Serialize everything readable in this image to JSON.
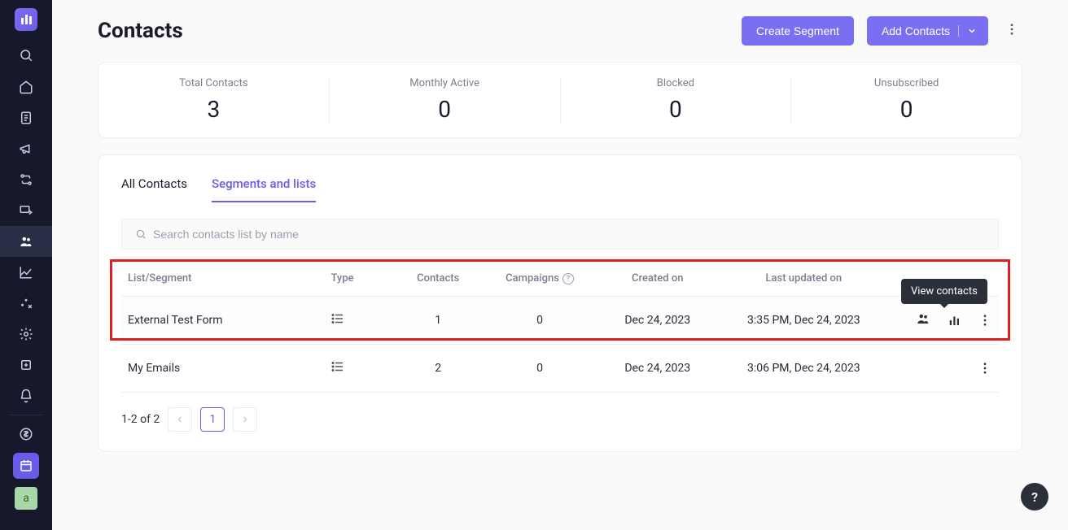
{
  "header": {
    "title": "Contacts",
    "create_segment_label": "Create Segment",
    "add_contacts_label": "Add Contacts"
  },
  "stats": [
    {
      "label": "Total Contacts",
      "value": "3"
    },
    {
      "label": "Monthly Active",
      "value": "0"
    },
    {
      "label": "Blocked",
      "value": "0"
    },
    {
      "label": "Unsubscribed",
      "value": "0"
    }
  ],
  "tabs": {
    "all_contacts": "All Contacts",
    "segments_lists": "Segments and lists"
  },
  "search": {
    "placeholder": "Search contacts list by name"
  },
  "table": {
    "columns": {
      "list_segment": "List/Segment",
      "type": "Type",
      "contacts": "Contacts",
      "campaigns": "Campaigns",
      "created_on": "Created on",
      "last_updated_on": "Last updated on"
    },
    "rows": [
      {
        "name": "External Test Form",
        "contacts": "1",
        "campaigns": "0",
        "created_on": "Dec 24, 2023",
        "last_updated_on": "3:35 PM, Dec 24, 2023"
      },
      {
        "name": "My Emails",
        "contacts": "2",
        "campaigns": "0",
        "created_on": "Dec 24, 2023",
        "last_updated_on": "3:06 PM, Dec 24, 2023"
      }
    ]
  },
  "tooltip": {
    "view_contacts": "View contacts"
  },
  "pagination": {
    "range": "1-2 of 2",
    "current": "1"
  },
  "sidebar_avatar": "a"
}
